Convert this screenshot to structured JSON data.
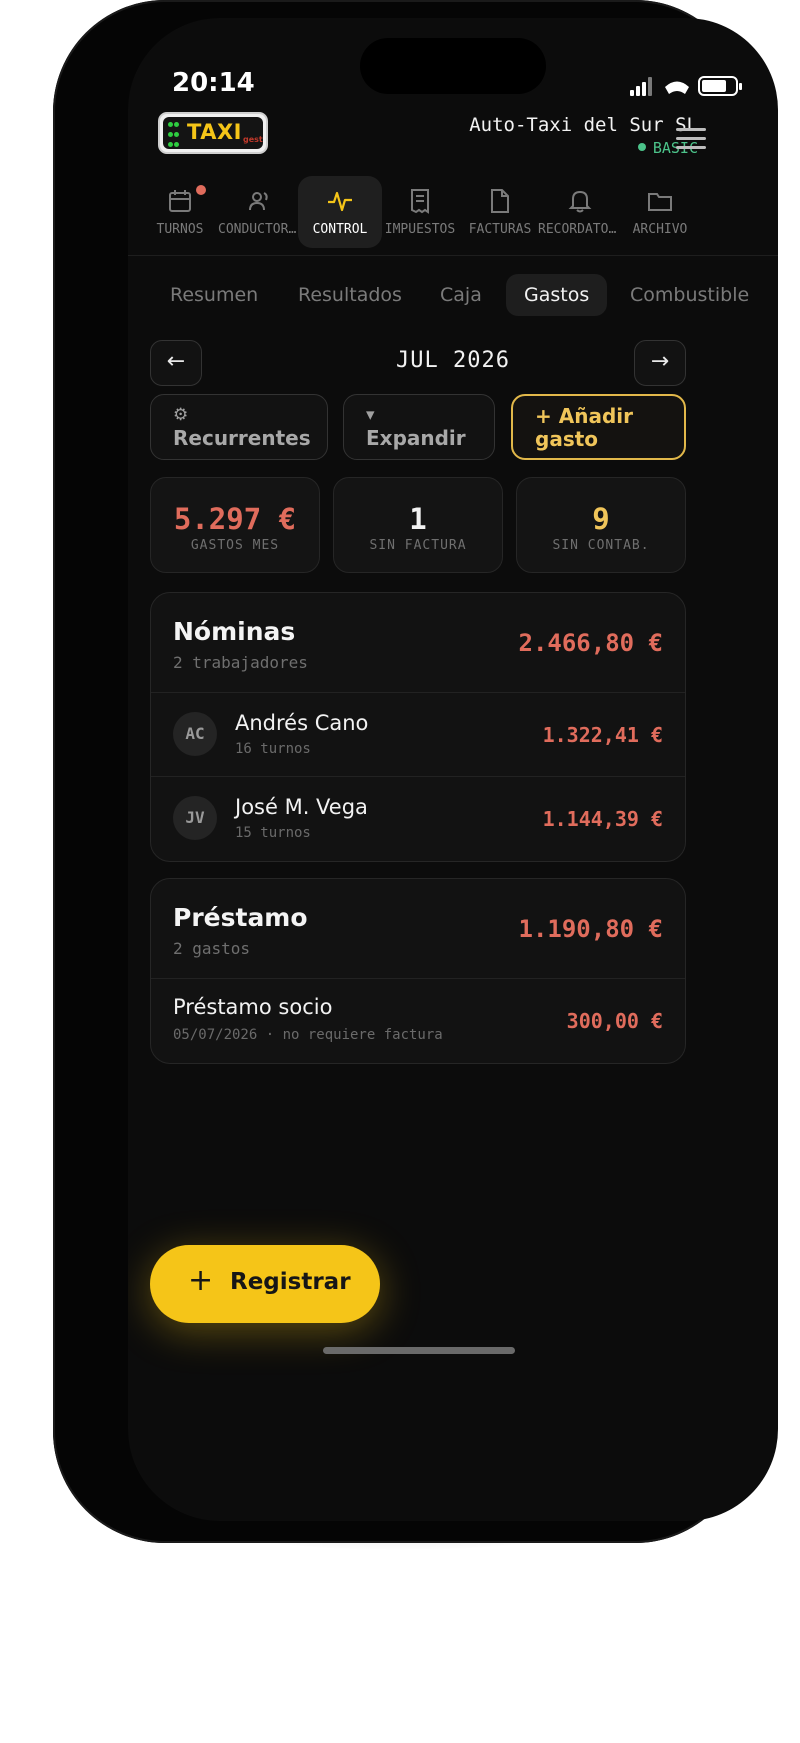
{
  "status_bar": {
    "time": "20:14"
  },
  "header": {
    "logo_text": "TAXI",
    "logo_sub": "gest",
    "company_name": "Auto-Taxi del Sur SL",
    "plan": "BASIC"
  },
  "nav": {
    "items": [
      {
        "label": "TURNOS",
        "icon": "calendar-icon",
        "badge": true
      },
      {
        "label": "CONDUCTORES",
        "icon": "users-icon"
      },
      {
        "label": "CONTROL",
        "icon": "pulse-icon",
        "active": true
      },
      {
        "label": "IMPUESTOS",
        "icon": "receipt-icon"
      },
      {
        "label": "FACTURAS",
        "icon": "file-icon"
      },
      {
        "label": "RECORDATORIOS",
        "icon": "bell-icon"
      },
      {
        "label": "ARCHIVO",
        "icon": "folder-icon"
      }
    ]
  },
  "tabs": [
    {
      "label": "Resumen"
    },
    {
      "label": "Resultados"
    },
    {
      "label": "Caja"
    },
    {
      "label": "Gastos",
      "active": true
    },
    {
      "label": "Combustible"
    }
  ],
  "period": {
    "prev_label": "←",
    "month_label": "JUL 2026",
    "next_label": "→"
  },
  "actions": {
    "recurring_icon": "⚙",
    "recurring_label": "Recurrentes",
    "expand_icon": "▾",
    "expand_label": "Expandir",
    "add_icon": "+",
    "add_label": "Añadir gasto"
  },
  "stats": [
    {
      "value": "5.297 €",
      "label": "GASTOS MES",
      "color": "#e06c5c"
    },
    {
      "value": "1",
      "label": "SIN FACTURA",
      "color": "#f2f2f2"
    },
    {
      "value": "9",
      "label": "SIN CONTAB.",
      "color": "#f0c55a"
    }
  ],
  "groups": {
    "nominas": {
      "title": "Nóminas",
      "subtitle": "2 trabajadores",
      "total": "2.466,80 €",
      "rows": [
        {
          "initials": "AC",
          "name": "Andrés Cano",
          "detail": "16 turnos",
          "amount": "1.322,41 €"
        },
        {
          "initials": "JV",
          "name": "José M. Vega",
          "detail": "15 turnos",
          "amount": "1.144,39 €"
        }
      ]
    },
    "prestamo": {
      "title": "Préstamo",
      "subtitle": "2 gastos",
      "total": "1.190,80 €",
      "rows": [
        {
          "name": "Préstamo socio",
          "detail": "05/07/2026 · no requiere factura",
          "amount": "300,00 €"
        }
      ]
    }
  },
  "fab": {
    "icon": "+",
    "label": "Registrar"
  },
  "colors": {
    "accent": "#f5c518",
    "expense": "#e06c5c",
    "plan": "#4cc38a"
  }
}
